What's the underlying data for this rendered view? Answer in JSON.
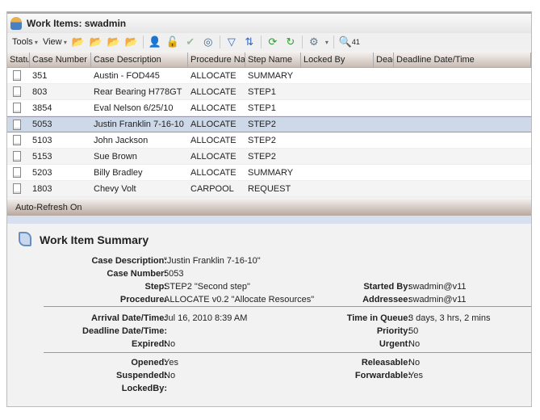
{
  "title": "Work Items: swadmin",
  "toolbar": {
    "tools": "Tools",
    "view": "View",
    "count": "41"
  },
  "columns": [
    "Statu",
    "Case Number",
    "Case Description",
    "Procedure Name",
    "Step Name",
    "Locked By",
    "Deadline",
    "Deadline Date/Time"
  ],
  "rows": [
    {
      "case": "351",
      "desc": "Austin - FOD445",
      "proc": "ALLOCATE",
      "step": "SUMMARY"
    },
    {
      "case": "803",
      "desc": "Rear Bearing H778GT",
      "proc": "ALLOCATE",
      "step": "STEP1"
    },
    {
      "case": "3854",
      "desc": "Eval Nelson 6/25/10",
      "proc": "ALLOCATE",
      "step": "STEP1"
    },
    {
      "case": "5053",
      "desc": "Justin Franklin 7-16-10",
      "proc": "ALLOCATE",
      "step": "STEP2"
    },
    {
      "case": "5103",
      "desc": "John Jackson",
      "proc": "ALLOCATE",
      "step": "STEP2"
    },
    {
      "case": "5153",
      "desc": "Sue Brown",
      "proc": "ALLOCATE",
      "step": "STEP2"
    },
    {
      "case": "5203",
      "desc": "Billy Bradley",
      "proc": "ALLOCATE",
      "step": "SUMMARY"
    },
    {
      "case": "1803",
      "desc": "Chevy Volt",
      "proc": "CARPOOL",
      "step": "REQUEST"
    }
  ],
  "status": "Auto-Refresh On",
  "summary": {
    "title": "Work Item Summary",
    "labels": {
      "desc": "Case Description:",
      "num": "Case Number:",
      "step": "Step:",
      "proc": "Procedure:",
      "started": "Started By:",
      "addr": "Addressee:",
      "arrival": "Arrival Date/Time:",
      "deadline": "Deadline Date/Time:",
      "expired": "Expired:",
      "tiq": "Time in Queue:",
      "priority": "Priority:",
      "urgent": "Urgent:",
      "opened": "Opened:",
      "suspended": "Suspended:",
      "locked": "LockedBy:",
      "releasable": "Releasable:",
      "forwardable": "Forwardable:"
    },
    "values": {
      "desc": "\"Justin Franklin 7-16-10\"",
      "num": "5053",
      "step": "STEP2 \"Second step\"",
      "proc": "ALLOCATE v0.2 \"Allocate Resources\"",
      "started": "swadmin@v11",
      "addr": "swadmin@v11",
      "arrival": "Jul 16, 2010 8:39 AM",
      "expired": "No",
      "tiq": "3 days, 3 hrs, 2 mins",
      "priority": "50",
      "urgent": "No",
      "opened": "Yes",
      "suspended": "No",
      "releasable": "No",
      "forwardable": "Yes"
    }
  }
}
